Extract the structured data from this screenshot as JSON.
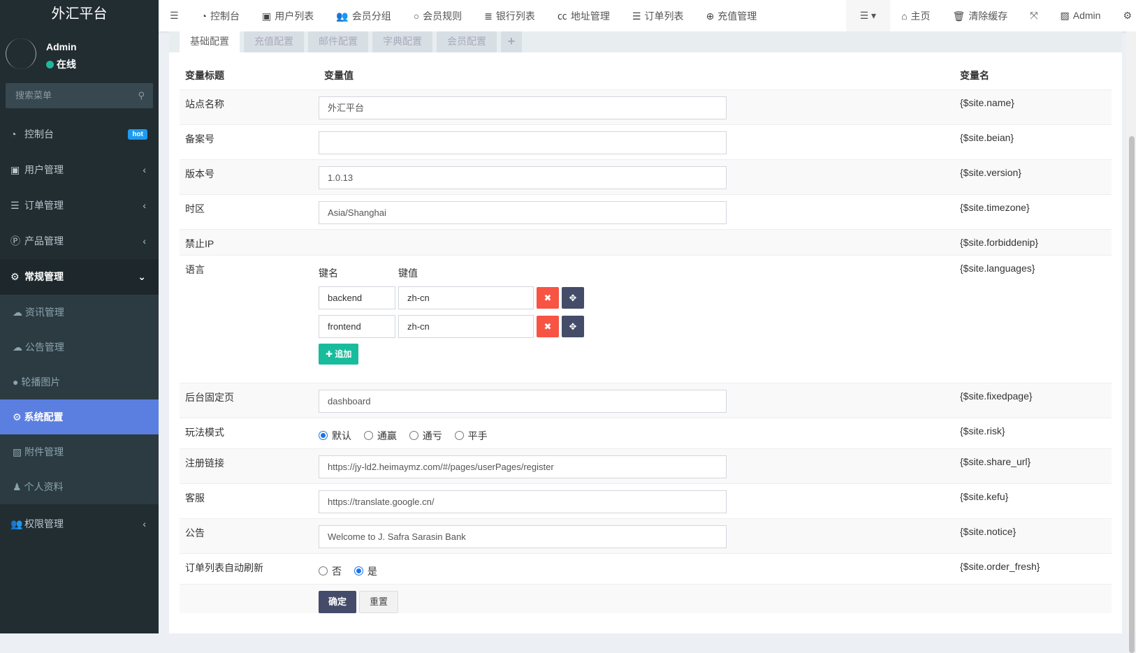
{
  "sidebar": {
    "logo": "外汇平台",
    "user": "Admin",
    "status": "在线",
    "search_placeholder": "搜索菜单",
    "items": [
      {
        "label": "控制台",
        "badge": "hot",
        "icon": "dashboard-icon"
      },
      {
        "label": "用户管理",
        "icon": "user-card-icon"
      },
      {
        "label": "订单管理",
        "icon": "list-icon"
      },
      {
        "label": "产品管理",
        "icon": "product-icon"
      },
      {
        "label": "常规管理",
        "icon": "cogs-icon"
      },
      {
        "label": "权限管理",
        "icon": "group-icon"
      }
    ],
    "sub": [
      {
        "label": "资讯管理"
      },
      {
        "label": "公告管理"
      },
      {
        "label": "轮播图片"
      },
      {
        "label": "系统配置"
      },
      {
        "label": "附件管理"
      },
      {
        "label": "个人资料"
      }
    ]
  },
  "topnav": {
    "items": [
      "控制台",
      "用户列表",
      "会员分组",
      "会员规则",
      "银行列表",
      "地址管理",
      "订单列表",
      "充值管理"
    ],
    "home": "主页",
    "clear_cache": "清除缓存",
    "admin": "Admin"
  },
  "tabs": [
    "基础配置",
    "充值配置",
    "邮件配置",
    "字典配置",
    "会员配置",
    "+"
  ],
  "table": {
    "headers": [
      "变量标题",
      "变量值",
      "变量名"
    ],
    "rows": [
      {
        "title": "站点名称",
        "value": "外汇平台",
        "var": "{$site.name}"
      },
      {
        "title": "备案号",
        "value": "",
        "var": "{$site.beian}"
      },
      {
        "title": "版本号",
        "value": "1.0.13",
        "var": "{$site.version}"
      },
      {
        "title": "时区",
        "value": "Asia/Shanghai",
        "var": "{$site.timezone}"
      },
      {
        "title": "禁止IP",
        "var": "{$site.forbiddenip}"
      },
      {
        "title": "语言",
        "var": "{$site.languages}",
        "key_label": "键名",
        "val_label": "键值",
        "pairs": [
          {
            "k": "backend",
            "v": "zh-cn"
          },
          {
            "k": "frontend",
            "v": "zh-cn"
          }
        ],
        "add": "追加"
      },
      {
        "title": "后台固定页",
        "value": "dashboard",
        "var": "{$site.fixedpage}"
      },
      {
        "title": "玩法模式",
        "var": "{$site.risk}",
        "options": [
          "默认",
          "通赢",
          "通亏",
          "平手"
        ],
        "selected": "默认"
      },
      {
        "title": "注册链接",
        "value": "https://jy-ld2.heimaymz.com/#/pages/userPages/register",
        "var": "{$site.share_url}"
      },
      {
        "title": "客服",
        "value": "https://translate.google.cn/",
        "var": "{$site.kefu}"
      },
      {
        "title": "公告",
        "value": "Welcome to J. Safra Sarasin Bank",
        "var": "{$site.notice}"
      },
      {
        "title": "订单列表自动刷新",
        "var": "{$site.order_fresh}",
        "options": [
          "否",
          "是"
        ],
        "selected": "是"
      }
    ]
  },
  "buttons": {
    "ok": "确定",
    "reset": "重置"
  }
}
